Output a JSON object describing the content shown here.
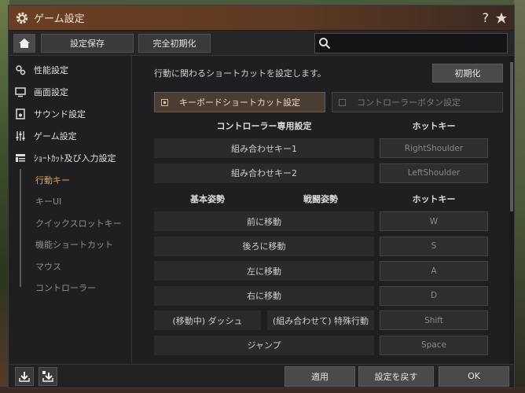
{
  "window": {
    "title": "ゲーム設定",
    "help_label": "?"
  },
  "toolbar": {
    "save_label": "設定保存",
    "reset_label": "完全初期化",
    "search_placeholder": ""
  },
  "sidebar": {
    "items": [
      {
        "label": "性能設定",
        "icon": "performance-icon"
      },
      {
        "label": "画面設定",
        "icon": "monitor-icon"
      },
      {
        "label": "サウンド設定",
        "icon": "speaker-icon"
      },
      {
        "label": "ゲーム設定",
        "icon": "sliders-icon"
      },
      {
        "label": "ｼｮｰﾄｶｯﾄ及び入力設定",
        "icon": "list-icon"
      }
    ],
    "subitems": [
      {
        "label": "行動キー",
        "active": true
      },
      {
        "label": "キーUI",
        "active": false
      },
      {
        "label": "クイックスロットキー",
        "active": false
      },
      {
        "label": "機能ショートカット",
        "active": false
      },
      {
        "label": "マウス",
        "active": false
      },
      {
        "label": "コントローラー",
        "active": false
      }
    ]
  },
  "main": {
    "description": "行動に関わるショートカットを設定します。",
    "init_label": "初期化",
    "mode_keyboard": "キーボードショートカット設定",
    "mode_controller": "コントローラーボタン設定",
    "controller_header": "コントローラー専用設定",
    "hotkey_header": "ホットキー",
    "controller_rows": [
      {
        "action": "組み合わせキー1",
        "key": "RightShoulder"
      },
      {
        "action": "組み合わせキー2",
        "key": "LeftShoulder"
      }
    ],
    "basic_header": "基本姿勢",
    "combat_header": "戦闘姿勢",
    "action_rows": [
      {
        "action": "前に移動",
        "key": "W"
      },
      {
        "action": "後ろに移動",
        "key": "S"
      },
      {
        "action": "左に移動",
        "key": "A"
      },
      {
        "action": "右に移動",
        "key": "D"
      },
      {
        "action_left": "(移動中) ダッシュ",
        "action_right": "(組み合わせて) 特殊行動",
        "key": "Shift"
      },
      {
        "action": "ジャンプ",
        "key": "Space"
      }
    ]
  },
  "footer": {
    "apply_label": "適用",
    "undo_label": "設定を戻す",
    "ok_label": "OK"
  },
  "colors": {
    "accent": "#e8a35a",
    "titlebar": "#6b3e22"
  }
}
